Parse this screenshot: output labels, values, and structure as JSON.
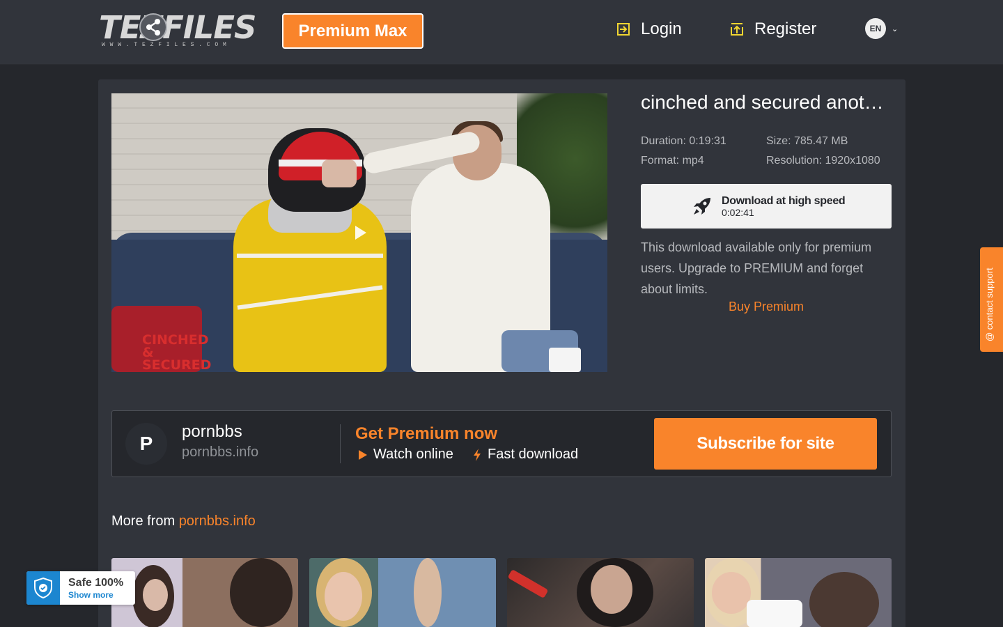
{
  "header": {
    "logo_text": "TEZFILES",
    "logo_sub": "WWW.TEZFILES.COM",
    "premium_max_label": "Premium Max",
    "login_label": "Login",
    "register_label": "Register",
    "language": "EN"
  },
  "file": {
    "title": "cinched and secured anot…",
    "duration": "Duration: 0:19:31",
    "size": "Size: 785.47 MB",
    "format": "Format: mp4",
    "resolution": "Resolution: 1920x1080",
    "thumbnail_watermark": "CINCHED & SECURED"
  },
  "download": {
    "label": "Download at high speed",
    "time": "0:02:41",
    "notice": "This download available only for premium users. Upgrade to PREMIUM and forget about limits.",
    "buy_premium_label": "Buy Premium"
  },
  "site": {
    "avatar_letter": "P",
    "name": "pornbbs",
    "domain": "pornbbs.info",
    "get_premium_label": "Get Premium now",
    "feature_watch": "Watch online",
    "feature_fast": "Fast download",
    "subscribe_label": "Subscribe for site"
  },
  "more": {
    "prefix": "More from ",
    "link": "pornbbs.info"
  },
  "support": {
    "label": "@ contact support"
  },
  "safe": {
    "title": "Safe 100%",
    "show_more": "Show more"
  },
  "colors": {
    "accent": "#f9842b",
    "header_bg": "#31343b",
    "page_bg": "#25272c",
    "safe_blue": "#1c86d0",
    "icon_yellow": "#f2d631"
  }
}
